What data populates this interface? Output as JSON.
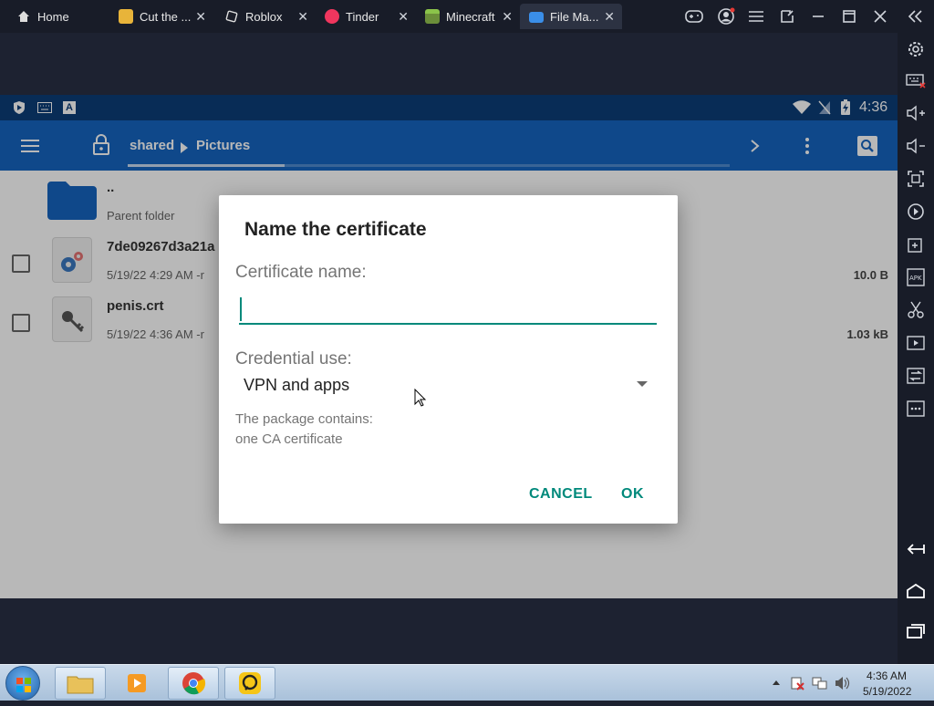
{
  "emulator": {
    "tabs": [
      {
        "label": "Home",
        "icon": "home-icon",
        "color": "#ffffff"
      },
      {
        "label": "Cut the ...",
        "icon": "cut-the-rope-icon",
        "color": "#e8b43a"
      },
      {
        "label": "Roblox",
        "icon": "roblox-icon",
        "color": "#dddddd"
      },
      {
        "label": "Tinder",
        "icon": "tinder-icon",
        "color": "#f0365e"
      },
      {
        "label": "Minecraft",
        "icon": "minecraft-icon",
        "color": "#6b8e3a"
      },
      {
        "label": "File Ma...",
        "icon": "folder-icon",
        "color": "#3a8ee8"
      }
    ],
    "active_tab": "File Ma...",
    "accent": "#3a8ee8"
  },
  "android": {
    "status_time": "4:36",
    "appbar_color": "#1565c0",
    "statusbar_color": "#0c3d78",
    "breadcrumb": [
      "shared",
      "Pictures"
    ],
    "files": [
      {
        "name": "..",
        "meta": "Parent folder",
        "size": "",
        "type": "folder"
      },
      {
        "name": "7de09267d3a21a",
        "meta": "5/19/22 4:29 AM  -r",
        "size": "10.0 B",
        "type": "settings-file"
      },
      {
        "name": "penis.crt",
        "meta": "5/19/22 4:36 AM  -r",
        "size": "1.03 kB",
        "type": "certificate"
      }
    ]
  },
  "dialog": {
    "title": "Name the certificate",
    "cert_name_label": "Certificate name:",
    "cert_name_value": "",
    "credential_label": "Credential use:",
    "credential_value": "VPN and apps",
    "package_line1": "The package contains:",
    "package_line2": "one CA certificate",
    "cancel_label": "CANCEL",
    "ok_label": "OK",
    "accent": "#00897b"
  },
  "taskbar": {
    "time": "4:36 AM",
    "date": "5/19/2022"
  }
}
